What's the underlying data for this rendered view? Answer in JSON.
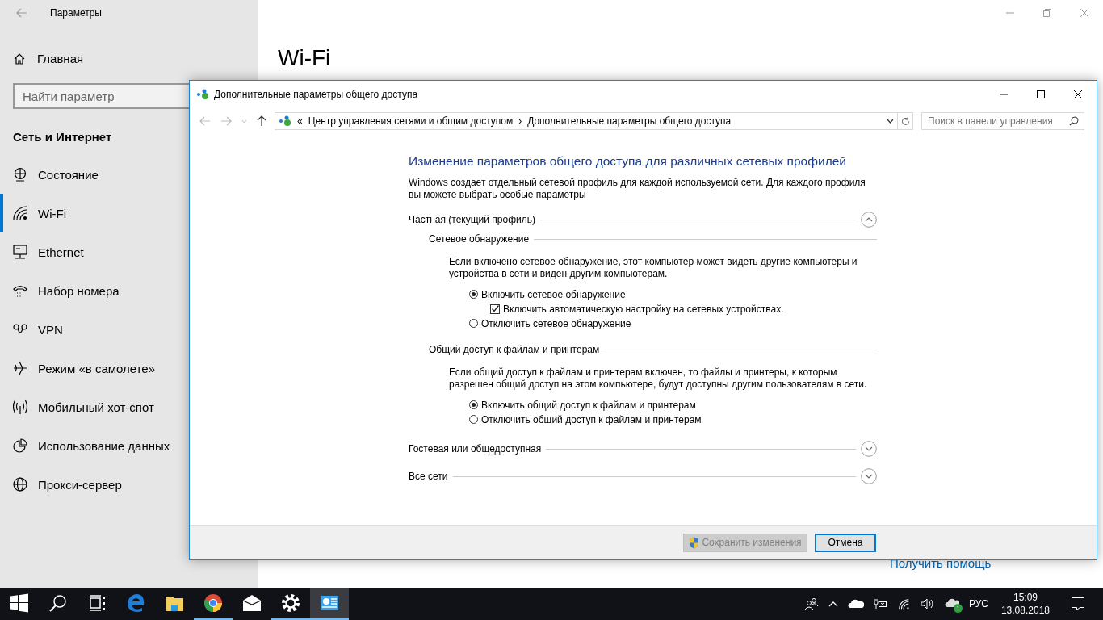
{
  "settings": {
    "title": "Параметры",
    "home": "Главная",
    "search": {
      "placeholder": "Найти параметр"
    },
    "section": "Сеть и Интернет",
    "nav": [
      {
        "label": "Состояние",
        "selected": false
      },
      {
        "label": "Wi-Fi",
        "selected": true
      },
      {
        "label": "Ethernet",
        "selected": false
      },
      {
        "label": "Набор номера",
        "selected": false
      },
      {
        "label": "VPN",
        "selected": false
      },
      {
        "label": "Режим «в самолете»",
        "selected": false
      },
      {
        "label": "Мобильный хот-спот",
        "selected": false
      },
      {
        "label": "Использование данных",
        "selected": false
      },
      {
        "label": "Прокси-сервер",
        "selected": false
      }
    ],
    "page_title": "Wi-Fi",
    "help_link": "Получить помощь"
  },
  "dialog": {
    "title": "Дополнительные параметры общего доступа",
    "address": {
      "prefix": "«",
      "separator": "›",
      "crumbs": [
        "Центр управления сетями и общим доступом",
        "Дополнительные параметры общего доступа"
      ]
    },
    "search": {
      "placeholder": "Поиск в панели управления"
    },
    "heading": "Изменение параметров общего доступа для различных сетевых профилей",
    "intro": "Windows создает отдельный сетевой профиль для каждой используемой сети. Для каждого профиля вы можете выбрать особые параметры",
    "profiles": [
      {
        "label": "Частная (текущий профиль)",
        "expanded": true,
        "sections": [
          {
            "title": "Сетевое обнаружение",
            "description": "Если включено сетевое обнаружение, этот компьютер может видеть другие компьютеры и устройства в сети и виден другим компьютерам.",
            "options": [
              {
                "kind": "radio",
                "label": "Включить сетевое обнаружение",
                "selected": true,
                "children": [
                  {
                    "kind": "checkbox",
                    "label": "Включить автоматическую настройку на сетевых устройствах.",
                    "checked": true
                  }
                ]
              },
              {
                "kind": "radio",
                "label": "Отключить сетевое обнаружение",
                "selected": false
              }
            ]
          },
          {
            "title": "Общий доступ к файлам и принтерам",
            "description": "Если общий доступ к файлам и принтерам включен, то файлы и принтеры, к которым разрешен общий доступ на этом компьютере, будут доступны другим пользователям в сети.",
            "options": [
              {
                "kind": "radio",
                "label": "Включить общий доступ к файлам и принтерам",
                "selected": true
              },
              {
                "kind": "radio",
                "label": "Отключить общий доступ к файлам и принтерам",
                "selected": false
              }
            ]
          }
        ]
      },
      {
        "label": "Гостевая или общедоступная",
        "expanded": false
      },
      {
        "label": "Все сети",
        "expanded": false
      }
    ],
    "buttons": [
      {
        "label": "Сохранить изменения",
        "kind": "shield",
        "disabled": true
      },
      {
        "label": "Отмена",
        "kind": "plain",
        "disabled": false
      }
    ]
  },
  "taskbar": {
    "apps": [
      {
        "running": false,
        "active": false
      },
      {
        "running": false,
        "active": false
      },
      {
        "running": false,
        "active": false
      },
      {
        "running": false,
        "active": false
      },
      {
        "running": false,
        "active": false
      },
      {
        "running": true,
        "active": false
      },
      {
        "running": false,
        "active": false
      },
      {
        "running": true,
        "active": false
      },
      {
        "running": true,
        "active": true
      }
    ],
    "tray": {
      "badge": "1",
      "language": "РУС",
      "time": "15:09",
      "date": "13.08.2018"
    }
  }
}
